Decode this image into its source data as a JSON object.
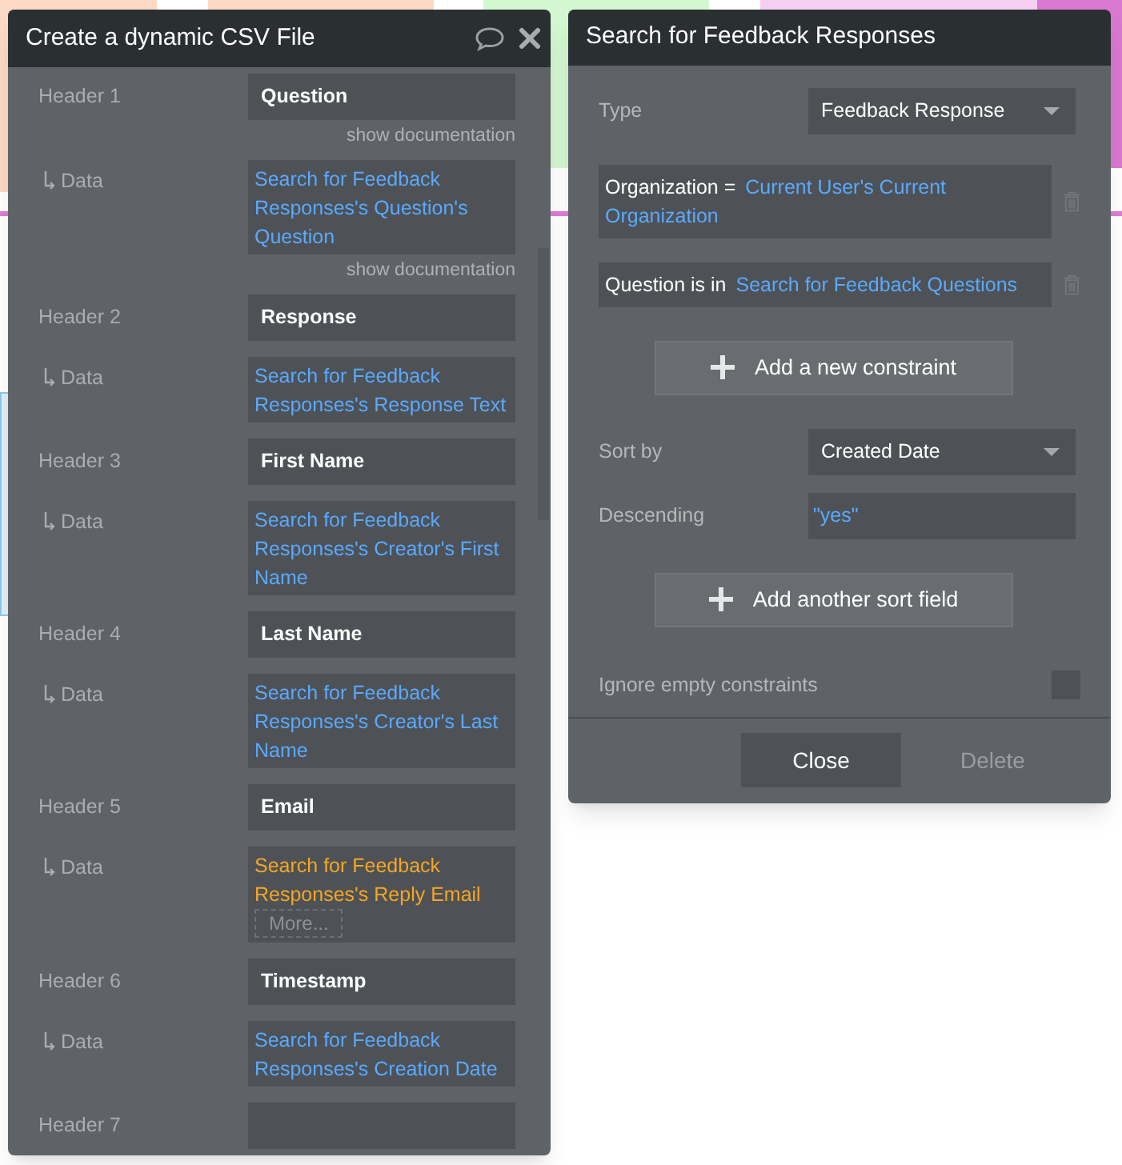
{
  "csv_panel": {
    "title": "Create a dynamic CSV File",
    "fields": [
      {
        "kind": "header",
        "label": "Header 1",
        "value": "Question",
        "doc_link": "show documentation"
      },
      {
        "kind": "data",
        "label": "Data",
        "value": "Search for Feedback Responses's Question's Question",
        "color": "#5aa9ff",
        "doc_link": "show documentation"
      },
      {
        "kind": "header",
        "label": "Header 2",
        "value": "Response"
      },
      {
        "kind": "data",
        "label": "Data",
        "value": "Search for Feedback Responses's Response Text",
        "color": "#5aa9ff"
      },
      {
        "kind": "header",
        "label": "Header 3",
        "value": "First Name"
      },
      {
        "kind": "data",
        "label": "Data",
        "value": "Search for Feedback Responses's Creator's First Name",
        "color": "#5aa9ff"
      },
      {
        "kind": "header",
        "label": "Header 4",
        "value": "Last Name"
      },
      {
        "kind": "data",
        "label": "Data",
        "value": "Search for Feedback Responses's Creator's Last Name",
        "color": "#5aa9ff"
      },
      {
        "kind": "header",
        "label": "Header 5",
        "value": "Email"
      },
      {
        "kind": "data",
        "label": "Data",
        "value": "Search for Feedback Responses's Reply Email",
        "color": "#f5a623",
        "more": "More..."
      },
      {
        "kind": "header",
        "label": "Header 6",
        "value": "Timestamp"
      },
      {
        "kind": "data",
        "label": "Data",
        "value": "Search for Feedback Responses's Creation Date",
        "color": "#5aa9ff"
      },
      {
        "kind": "header",
        "label": "Header 7"
      }
    ]
  },
  "search_panel": {
    "title": "Search for Feedback Responses",
    "type": {
      "label": "Type",
      "value": "Feedback Response"
    },
    "constraints": [
      {
        "field": "Organization =",
        "value": "Current User's Current Organization"
      },
      {
        "field": "Question is in",
        "value": "Search for Feedback Questions"
      }
    ],
    "add_constraint": "Add a new constraint",
    "sort_by": {
      "label": "Sort by",
      "value": "Created Date"
    },
    "descending": {
      "label": "Descending",
      "value": "\"yes\""
    },
    "add_sort": "Add another sort field",
    "ignore_empty": {
      "label": "Ignore empty constraints",
      "checked": false
    },
    "buttons": [
      {
        "label": "Close",
        "disabled": false
      },
      {
        "label": "Delete",
        "disabled": true
      }
    ]
  }
}
